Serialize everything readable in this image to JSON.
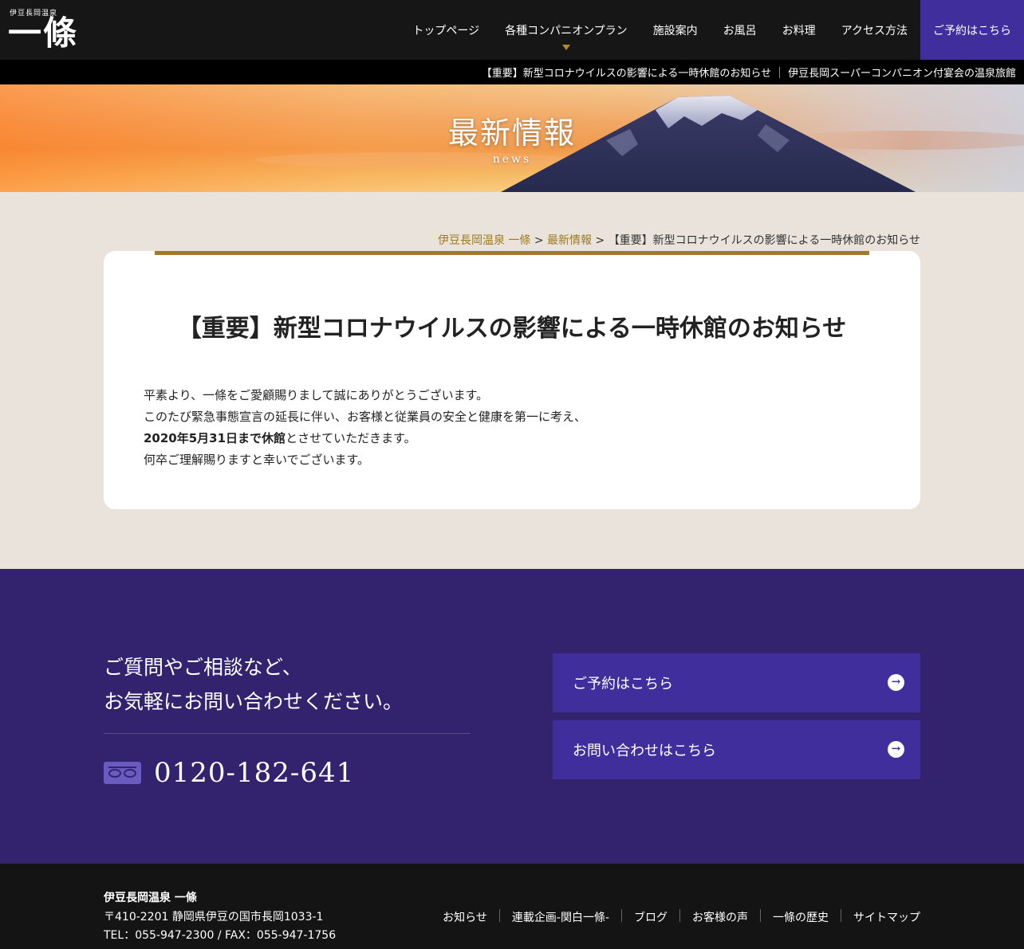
{
  "header": {
    "logo_small": "伊豆長岡温泉",
    "logo_main": "一條",
    "nav": [
      "トップページ",
      "各種コンパニオンプラン",
      "施設案内",
      "お風呂",
      "お料理",
      "アクセス方法"
    ],
    "reserve": "ご予約はこちら"
  },
  "ticker": {
    "item1": "【重要】新型コロナウイルスの影響による一時休館のお知らせ",
    "item2": "伊豆長岡スーパーコンパニオン付宴会の温泉旅館"
  },
  "hero": {
    "title": "最新情報",
    "subtitle": "news"
  },
  "breadcrumb": {
    "home": "伊豆長岡温泉 一條",
    "sep1": " > ",
    "section": "最新情報",
    "sep2": " > ",
    "current": "【重要】新型コロナウイルスの影響による一時休館のお知らせ"
  },
  "article": {
    "title": "【重要】新型コロナウイルスの影響による一時休館のお知らせ",
    "line1": "平素より、一條をご愛顧賜りまして誠にありがとうございます。",
    "line2": "このたび緊急事態宣言の延長に伴い、お客様と従業員の安全と健康を第一に考え、",
    "line3_bold": "2020年5月31日まで休館",
    "line3_rest": "とさせていただきます。",
    "line4": "何卒ご理解賜りますと幸いでございます。"
  },
  "contact": {
    "line1": "ご質問やご相談など、",
    "line2": "お気軽にお問い合わせください。",
    "phone": "0120-182-641",
    "reserve_button": "ご予約はこちら",
    "inquiry_button": "お問い合わせはこちら"
  },
  "footer": {
    "name": "伊豆長岡温泉 一條",
    "address": "〒410-2201 静岡県伊豆の国市長岡1033-1",
    "tel": "TEL：055-947-2300 / FAX：055-947-1756",
    "links": [
      "お知らせ",
      "連載企画-関白一條-",
      "ブログ",
      "お客様の声",
      "一條の歴史",
      "サイトマップ"
    ]
  },
  "colors": {
    "accent_purple": "#3f2e9c",
    "gold": "#a07a26",
    "dark": "#161616"
  }
}
